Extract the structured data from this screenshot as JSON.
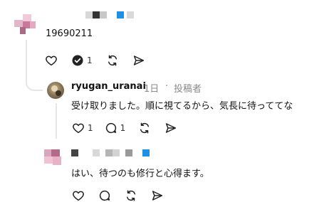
{
  "posts": [
    {
      "id": "top",
      "body": "19690211",
      "likes": "",
      "reposted_count": "1",
      "comments": ""
    },
    {
      "id": "reply1",
      "username": "ryugan_uranai",
      "time": "1日",
      "separator": "·",
      "role": "投稿者",
      "body": "受け取りました。順に視てるから、気長に待っててな",
      "likes": "1",
      "comments": "1"
    },
    {
      "id": "reply2",
      "body": "はい、待つのも修行と心得ます。"
    }
  ],
  "icons": [
    "heart-icon",
    "repost-check-icon",
    "repost-icon",
    "share-icon",
    "comment-icon"
  ]
}
